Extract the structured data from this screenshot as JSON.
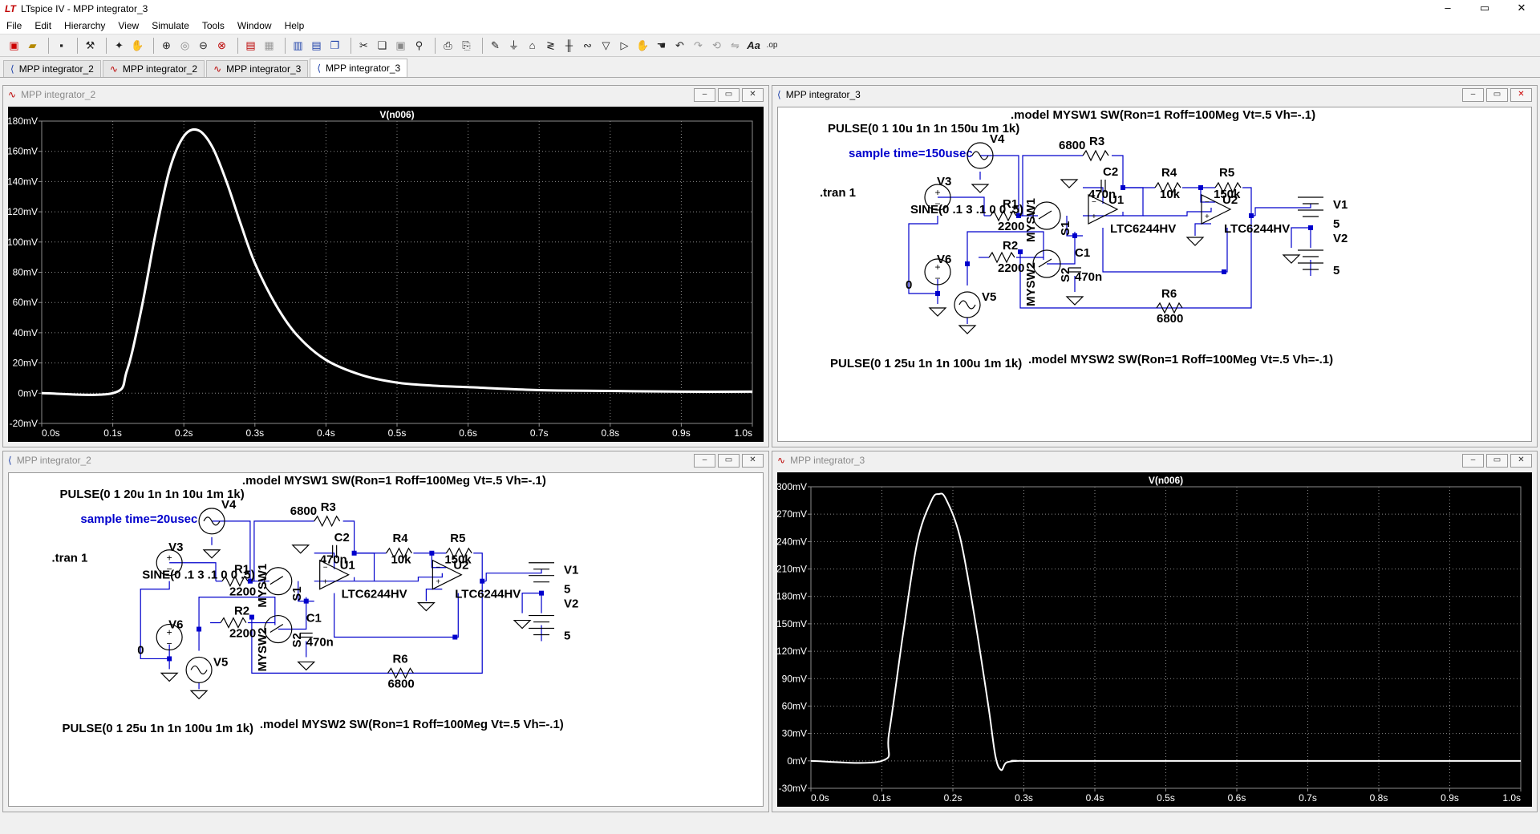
{
  "app": {
    "title": "LTspice IV - MPP integrator_3",
    "logo": "LT"
  },
  "menu": [
    "File",
    "Edit",
    "Hierarchy",
    "View",
    "Simulate",
    "Tools",
    "Window",
    "Help"
  ],
  "toolbar_icons": [
    "new-schematic-icon",
    "open-icon",
    "save-icon",
    "control-panel-icon",
    "run-icon",
    "halt-icon",
    "zoom-in-icon",
    "zoom-pan-icon",
    "zoom-out-icon",
    "zoom-fit-icon",
    "autoscale-icon",
    "grid-icon",
    "tile-vertical-icon",
    "tile-horizontal-icon",
    "cascade-icon",
    "cut-icon",
    "copy-icon",
    "paste-icon",
    "find-icon",
    "print-icon",
    "print-preview-icon",
    "wire-icon",
    "ground-icon",
    "label-icon",
    "resistor-icon",
    "capacitor-icon",
    "inductor-icon",
    "diode-icon",
    "component-icon",
    "move-icon",
    "drag-icon",
    "undo-icon",
    "redo-icon",
    "rotate-icon",
    "mirror-icon",
    "text-icon",
    "spice-directive-icon"
  ],
  "tabs": [
    {
      "label": "MPP integrator_2",
      "kind": "schematic"
    },
    {
      "label": "MPP integrator_2",
      "kind": "plot"
    },
    {
      "label": "MPP integrator_3",
      "kind": "plot"
    },
    {
      "label": "MPP integrator_3",
      "kind": "schematic",
      "active": true
    }
  ],
  "windows": {
    "top_left": {
      "title": "MPP integrator_2",
      "kind": "plot"
    },
    "top_right": {
      "title": "MPP integrator_3",
      "kind": "schematic"
    },
    "bottom_left": {
      "title": "MPP integrator_2",
      "kind": "schematic"
    },
    "bottom_right": {
      "title": "MPP integrator_3",
      "kind": "plot"
    }
  },
  "window_controls": {
    "minimize": "‒",
    "maximize": "▭",
    "close": "✕"
  },
  "schematic_top": {
    "model1": ".model MYSW1 SW(Ron=1 Roff=100Meg Vt=.5 Vh=-.1)",
    "model2": ".model MYSW2 SW(Ron=1 Roff=100Meg Vt=.5 Vh=-.1)",
    "pulse_v4": "PULSE(0 1 10u 1n 1n 150u 1m 1k)",
    "pulse_v5": "PULSE(0 1 25u 1n 1n 100u 1m 1k)",
    "sample_note": "sample time=150usec",
    "tran": ".tran 1",
    "sine": "SINE(0 .1 3 .1 0 0 .5)",
    "labels": {
      "V4": "V4",
      "V3": "V3",
      "V6": "V6",
      "V5": "V5",
      "V1": "V1",
      "V2": "V2",
      "R1": "R1",
      "R2": "R2",
      "R3": "R3",
      "R4": "R4",
      "R5": "R5",
      "R6": "R6",
      "C1": "C1",
      "C2": "C2",
      "U1": "U1",
      "U2": "U2",
      "S1": "S1",
      "S2": "S2",
      "MYSW1": "MYSW1",
      "MYSW2": "MYSW2",
      "opamp1": "LTC6244HV",
      "opamp2": "LTC6244HV"
    },
    "values": {
      "R1": "2200",
      "R2": "2200",
      "R3": "6800",
      "R4": "10k",
      "R5": "150k",
      "R6": "6800",
      "C1": "470n",
      "C2": "470n",
      "V1": "5",
      "V2": "5",
      "V6": "0"
    }
  },
  "schematic_bottom": {
    "model1": ".model MYSW1 SW(Ron=1 Roff=100Meg Vt=.5 Vh=-.1)",
    "model2": ".model MYSW2 SW(Ron=1 Roff=100Meg Vt=.5 Vh=-.1)",
    "pulse_v4": "PULSE(0 1 20u 1n 1n 10u 1m 1k)",
    "pulse_v5": "PULSE(0 1 25u 1n 1n 100u 1m 1k)",
    "sample_note": "sample time=20usec",
    "tran": ".tran 1",
    "sine": "SINE(0 .1 3 .1 0 0 .5)",
    "labels": {
      "V4": "V4",
      "V3": "V3",
      "V6": "V6",
      "V5": "V5",
      "V1": "V1",
      "V2": "V2",
      "R1": "R1",
      "R2": "R2",
      "R3": "R3",
      "R4": "R4",
      "R5": "R5",
      "R6": "R6",
      "C1": "C1",
      "C2": "C2",
      "U1": "U1",
      "U2": "U2",
      "S1": "S1",
      "S2": "S2",
      "MYSW1": "MYSW1",
      "MYSW2": "MYSW2",
      "opamp1": "LTC6244HV",
      "opamp2": "LTC6244HV"
    },
    "values": {
      "R1": "2200",
      "R2": "2200",
      "R3": "6800",
      "R4": "10k",
      "R5": "150k",
      "R6": "6800",
      "C1": "470n",
      "C2": "470n",
      "V1": "5",
      "V2": "5",
      "V6": "0"
    }
  },
  "chart_data": [
    {
      "type": "line",
      "title": "V(n006)",
      "x_ticks": [
        "0.0s",
        "0.1s",
        "0.2s",
        "0.3s",
        "0.4s",
        "0.5s",
        "0.6s",
        "0.7s",
        "0.8s",
        "0.9s",
        "1.0s"
      ],
      "y_ticks": [
        "180mV",
        "160mV",
        "140mV",
        "120mV",
        "100mV",
        "80mV",
        "60mV",
        "40mV",
        "20mV",
        "0mV",
        "-20mV"
      ],
      "xlim": [
        0,
        1.0
      ],
      "ylim": [
        -20,
        180
      ],
      "grid": true,
      "colors": {
        "background": "#000000",
        "trace": "#ffffff",
        "grid": "#8c8c8c"
      },
      "series": [
        {
          "x": [
            0,
            0.1,
            0.12,
            0.14,
            0.16,
            0.18,
            0.2,
            0.22,
            0.24,
            0.26,
            0.28,
            0.3,
            0.33,
            0.36,
            0.4,
            0.45,
            0.5,
            0.55,
            0.6,
            0.7,
            0.8,
            0.9,
            1.0
          ],
          "values": [
            0,
            0,
            15,
            55,
            105,
            148,
            170,
            174,
            163,
            140,
            112,
            86,
            58,
            38,
            22,
            12,
            7,
            5,
            4,
            2,
            1.5,
            1,
            1
          ]
        }
      ]
    },
    {
      "type": "line",
      "title": "V(n006)",
      "x_ticks": [
        "0.0s",
        "0.1s",
        "0.2s",
        "0.3s",
        "0.4s",
        "0.5s",
        "0.6s",
        "0.7s",
        "0.8s",
        "0.9s",
        "1.0s"
      ],
      "y_ticks": [
        "300mV",
        "270mV",
        "240mV",
        "210mV",
        "180mV",
        "150mV",
        "120mV",
        "90mV",
        "60mV",
        "30mV",
        "0mV",
        "-30mV"
      ],
      "xlim": [
        0,
        1.0
      ],
      "ylim": [
        -30,
        300
      ],
      "grid": true,
      "colors": {
        "background": "#000000",
        "trace": "#ffffff",
        "grid": "#8c8c8c"
      },
      "series": [
        {
          "x": [
            0,
            0.1,
            0.11,
            0.13,
            0.15,
            0.17,
            0.18,
            0.19,
            0.21,
            0.23,
            0.25,
            0.26,
            0.268,
            0.275,
            0.29,
            0.3,
            0.5,
            1.0
          ],
          "values": [
            0,
            0,
            30,
            140,
            240,
            285,
            292,
            287,
            245,
            160,
            60,
            5,
            -10,
            -2,
            0,
            0,
            0,
            0
          ]
        }
      ]
    }
  ]
}
